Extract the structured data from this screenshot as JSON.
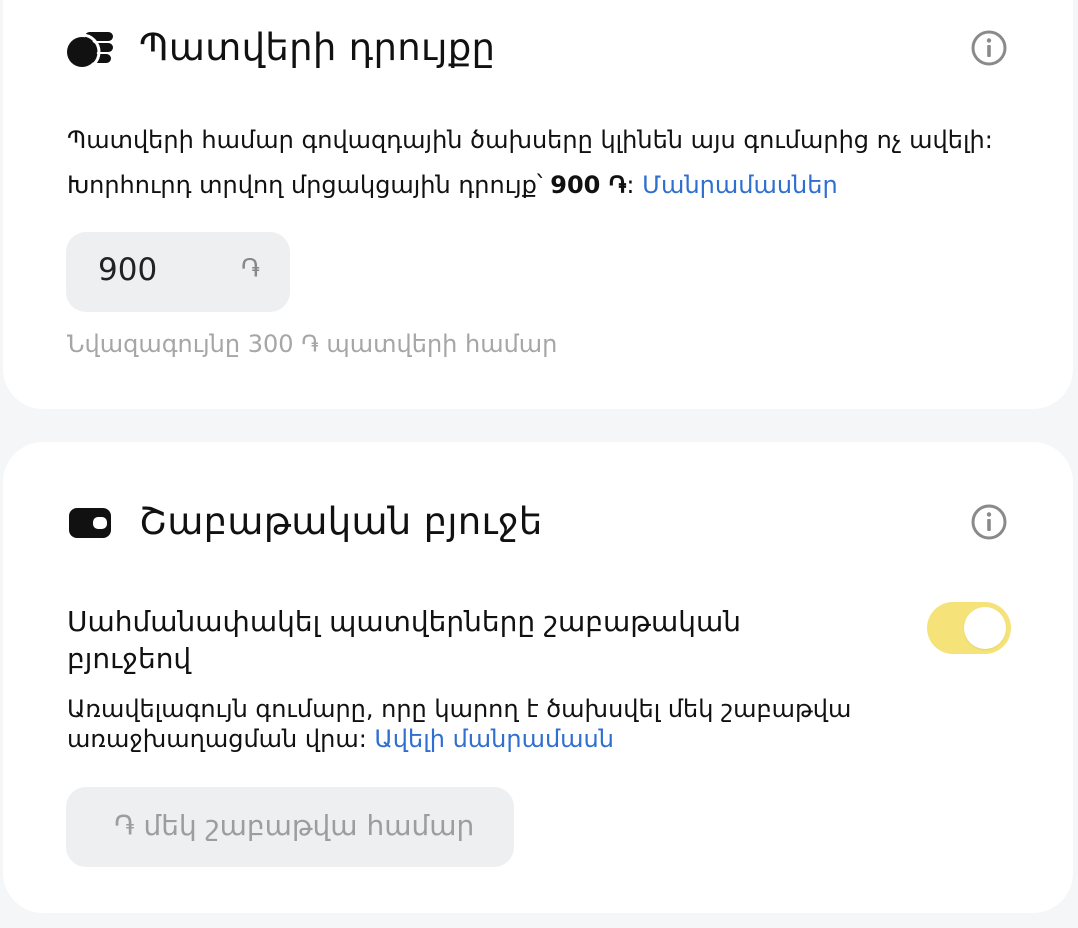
{
  "order_bid": {
    "title": "Պատվերի դրույքը",
    "description_line1": "Պատվերի համար գովազդային ծախսերը կլինեն այս գումարից ոչ ավելի:",
    "description_line2_prefix": "Խորհուրդ տրվող մրցակցային դրույք՝ ",
    "recommended_bid": "900 ֏",
    "description_line2_colon": ": ",
    "details_link": "Մանրամասներ",
    "bid_value": "900",
    "currency_symbol": "֏",
    "minimum_hint": "Նվազագույնը 300 ֏ պատվերի համար",
    "icon": "coins-icon"
  },
  "weekly_budget": {
    "title": "Շաբաթական բյուջե",
    "icon": "wallet-icon",
    "limit_label": "Սահմանափակել պատվերները շաբաթական բյուջեով",
    "limit_description": "Առավելագույն գումարը, որը կարող է ծախսվել մեկ շաբաթվա առաջխաղացման վրա: ",
    "more_link": "Ավելի մանրամասն",
    "toggle_on": true,
    "budget_placeholder": "֏ մեկ շաբաթվա համար"
  },
  "colors": {
    "accent_link": "#2f6fd0",
    "toggle_on": "#f5e37a",
    "input_bg": "#eeeff1",
    "page_bg": "#f5f6f8"
  }
}
